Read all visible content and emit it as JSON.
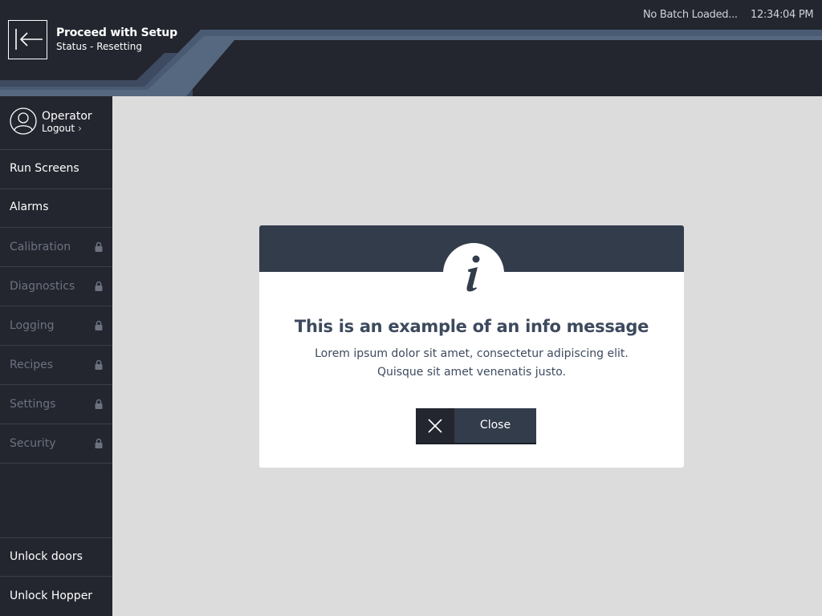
{
  "header": {
    "title": "Proceed with Setup",
    "status": "Status - Resetting",
    "batch": "No Batch Loaded...",
    "time": "12:34:04 PM",
    "back_icon": "arrow-left-icon"
  },
  "user": {
    "name": "Operator",
    "logout_label": "Logout",
    "chevron": "›",
    "avatar_icon": "user-avatar-icon"
  },
  "sidebar": {
    "items": [
      {
        "label": "Run Screens",
        "locked": false
      },
      {
        "label": "Alarms",
        "locked": false
      },
      {
        "label": "Calibration",
        "locked": true
      },
      {
        "label": "Diagnostics",
        "locked": true
      },
      {
        "label": "Logging",
        "locked": true
      },
      {
        "label": "Recipes",
        "locked": true
      },
      {
        "label": "Settings",
        "locked": true
      },
      {
        "label": "Security",
        "locked": true
      }
    ],
    "bottom_items": [
      {
        "label": "Unlock doors"
      },
      {
        "label": "Unlock Hopper"
      }
    ]
  },
  "dialog": {
    "icon": "info-icon",
    "title": "This is an example of an info message",
    "body_line1": "Lorem ipsum dolor sit amet, consectetur adipiscing elit.",
    "body_line2": "Quisque sit amet venenatis justo.",
    "close_label": "Close",
    "close_icon": "close-icon"
  },
  "colors": {
    "header_bg": "#23262f",
    "accent_stripe": "#4a5a72",
    "dialog_header": "#323c4b",
    "content_bg": "#dcdcdc",
    "text_dark": "#3d4a5e"
  }
}
